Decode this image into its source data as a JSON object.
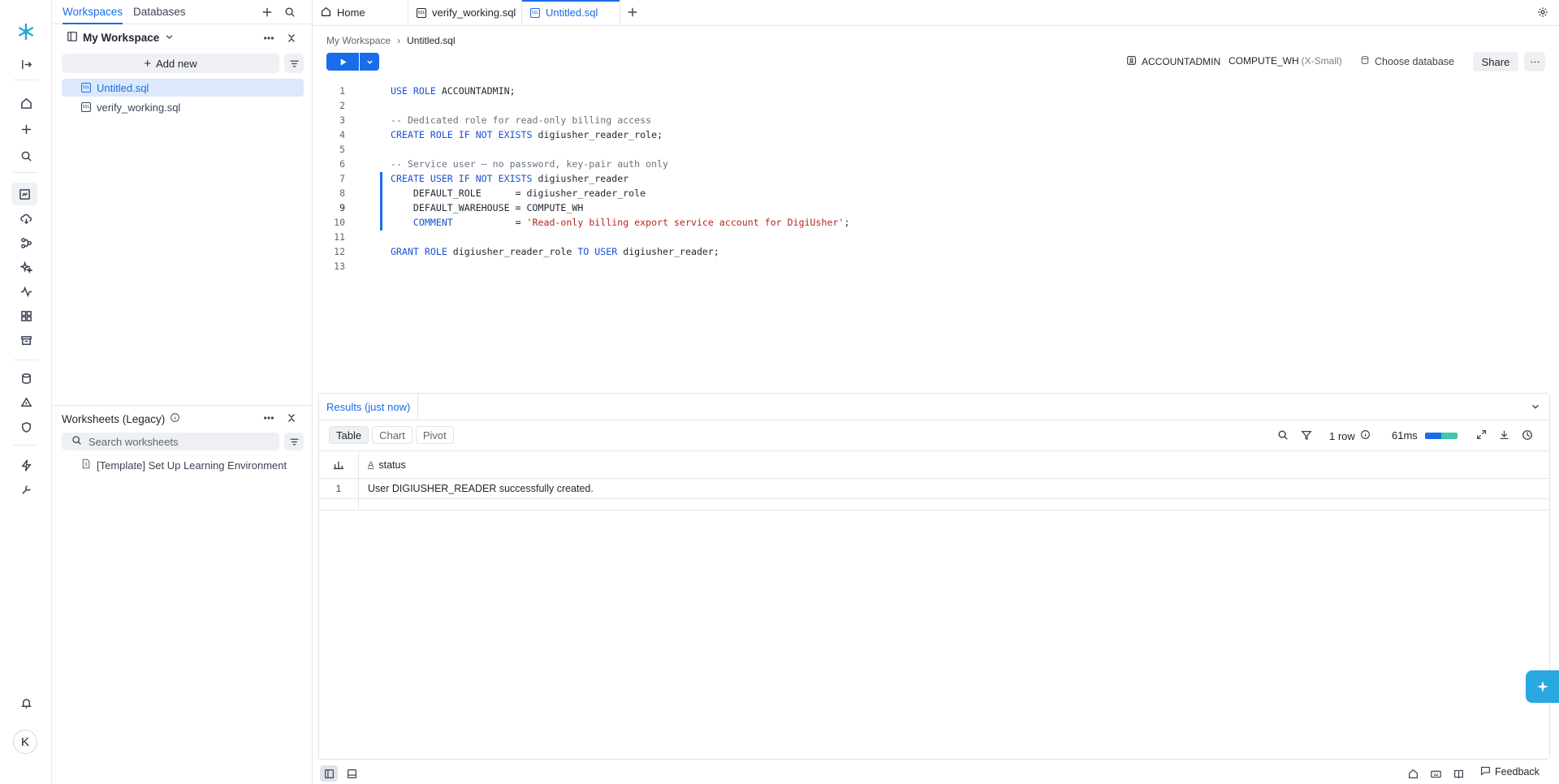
{
  "sidebar": {
    "tabs": [
      "Workspaces",
      "Databases"
    ],
    "workspace_name": "My Workspace",
    "add_new_label": "Add new",
    "files": [
      "Untitled.sql",
      "verify_working.sql"
    ],
    "legacy_title": "Worksheets (Legacy)",
    "search_placeholder": "Search worksheets",
    "template_item": "[Template] Set Up Learning Environment"
  },
  "editor_tabs": [
    {
      "label": "Home",
      "icon": "home-icon"
    },
    {
      "label": "verify_working.sql",
      "icon": "sql-file-icon"
    },
    {
      "label": "Untitled.sql",
      "icon": "sql-file-icon",
      "active": true
    }
  ],
  "breadcrumb": {
    "root": "My Workspace",
    "current": "Untitled.sql"
  },
  "context": {
    "role": "ACCOUNTADMIN",
    "warehouse": "COMPUTE_WH",
    "warehouse_size": "(X-Small)",
    "database": "Choose database",
    "share_label": "Share"
  },
  "code_lines": [
    "1",
    "2",
    "3",
    "4",
    "5",
    "6",
    "7",
    "8",
    "9",
    "10",
    "11",
    "12",
    "13"
  ],
  "results": {
    "tab_label": "Results (just now)",
    "views": [
      "Table",
      "Chart",
      "Pivot"
    ],
    "row_count": "1 row",
    "duration": "61ms",
    "column": "status",
    "rows": [
      {
        "num": "1",
        "status": "User DIGIUSHER_READER successfully created."
      }
    ]
  },
  "avatar_initial": "K",
  "feedback_label": "Feedback",
  "colors": {
    "accent": "#1a6ce8",
    "ai_button": "#29a8e0"
  }
}
